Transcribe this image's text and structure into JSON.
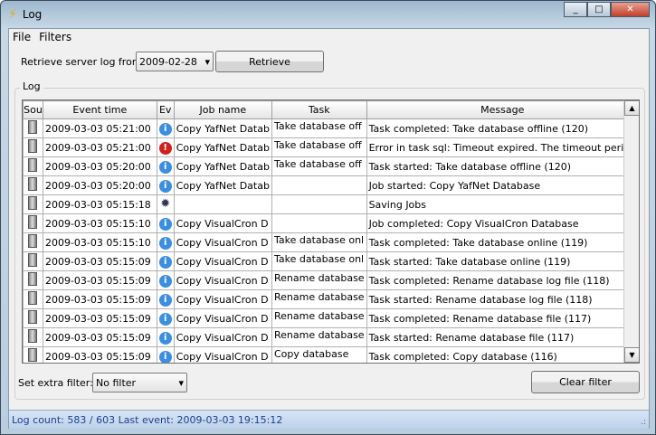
{
  "window": {
    "title": "Log",
    "controls": [
      "_",
      "□",
      "✕"
    ]
  },
  "menu": [
    "File",
    "Filters"
  ],
  "retrieve": {
    "label": "Retrieve server log from:",
    "date": "2009-02-28",
    "button": "Retrieve"
  },
  "group_label": "Log",
  "columns": [
    "Sou",
    "Event time",
    "Ev",
    "Job name",
    "Task",
    "Message"
  ],
  "rows": [
    {
      "time": "2009-03-03 05:21:00",
      "ev": "info",
      "job": "Copy YafNet Datab",
      "task": "Take database off",
      "msg": "Task completed: Take database offline (120)"
    },
    {
      "time": "2009-03-03 05:21:00",
      "ev": "error",
      "job": "Copy YafNet Datab",
      "task": "Take database off",
      "msg": "Error in task sql: Timeout expired.  The timeout period"
    },
    {
      "time": "2009-03-03 05:20:00",
      "ev": "info",
      "job": "Copy YafNet Datab",
      "task": "Take database off",
      "msg": "Task started: Take database offline (120)"
    },
    {
      "time": "2009-03-03 05:20:00",
      "ev": "info",
      "job": "Copy YafNet Datab",
      "task": "",
      "msg": "Job started: Copy YafNet Database"
    },
    {
      "time": "2009-03-03 05:15:18",
      "ev": "gear",
      "job": "",
      "task": "",
      "msg": "Saving Jobs"
    },
    {
      "time": "2009-03-03 05:15:10",
      "ev": "info",
      "job": "Copy VisualCron D",
      "task": "",
      "msg": "Job completed: Copy VisualCron Database"
    },
    {
      "time": "2009-03-03 05:15:10",
      "ev": "info",
      "job": "Copy VisualCron D",
      "task": "Take database onl",
      "msg": "Task completed: Take database online (119)"
    },
    {
      "time": "2009-03-03 05:15:09",
      "ev": "info",
      "job": "Copy VisualCron D",
      "task": "Take database onl",
      "msg": "Task started: Take database online (119)"
    },
    {
      "time": "2009-03-03 05:15:09",
      "ev": "info",
      "job": "Copy VisualCron D",
      "task": "Rename database",
      "msg": "Task completed: Rename database log file (118)"
    },
    {
      "time": "2009-03-03 05:15:09",
      "ev": "info",
      "job": "Copy VisualCron D",
      "task": "Rename database",
      "msg": "Task started: Rename database log file (118)"
    },
    {
      "time": "2009-03-03 05:15:09",
      "ev": "info",
      "job": "Copy VisualCron D",
      "task": "Rename database",
      "msg": "Task completed: Rename database file (117)"
    },
    {
      "time": "2009-03-03 05:15:09",
      "ev": "info",
      "job": "Copy VisualCron D",
      "task": "Rename database",
      "msg": "Task started: Rename database file (117)"
    },
    {
      "time": "2009-03-03 05:15:09",
      "ev": "info",
      "job": "Copy VisualCron D",
      "task": "Copy database",
      "msg": "Task completed: Copy database (116)"
    }
  ],
  "filter": {
    "label": "Set extra filter:",
    "value": "No filter",
    "clear": "Clear filter"
  },
  "status": "Log count: 583 / 603   Last event: 2009-03-03 19:15:12"
}
